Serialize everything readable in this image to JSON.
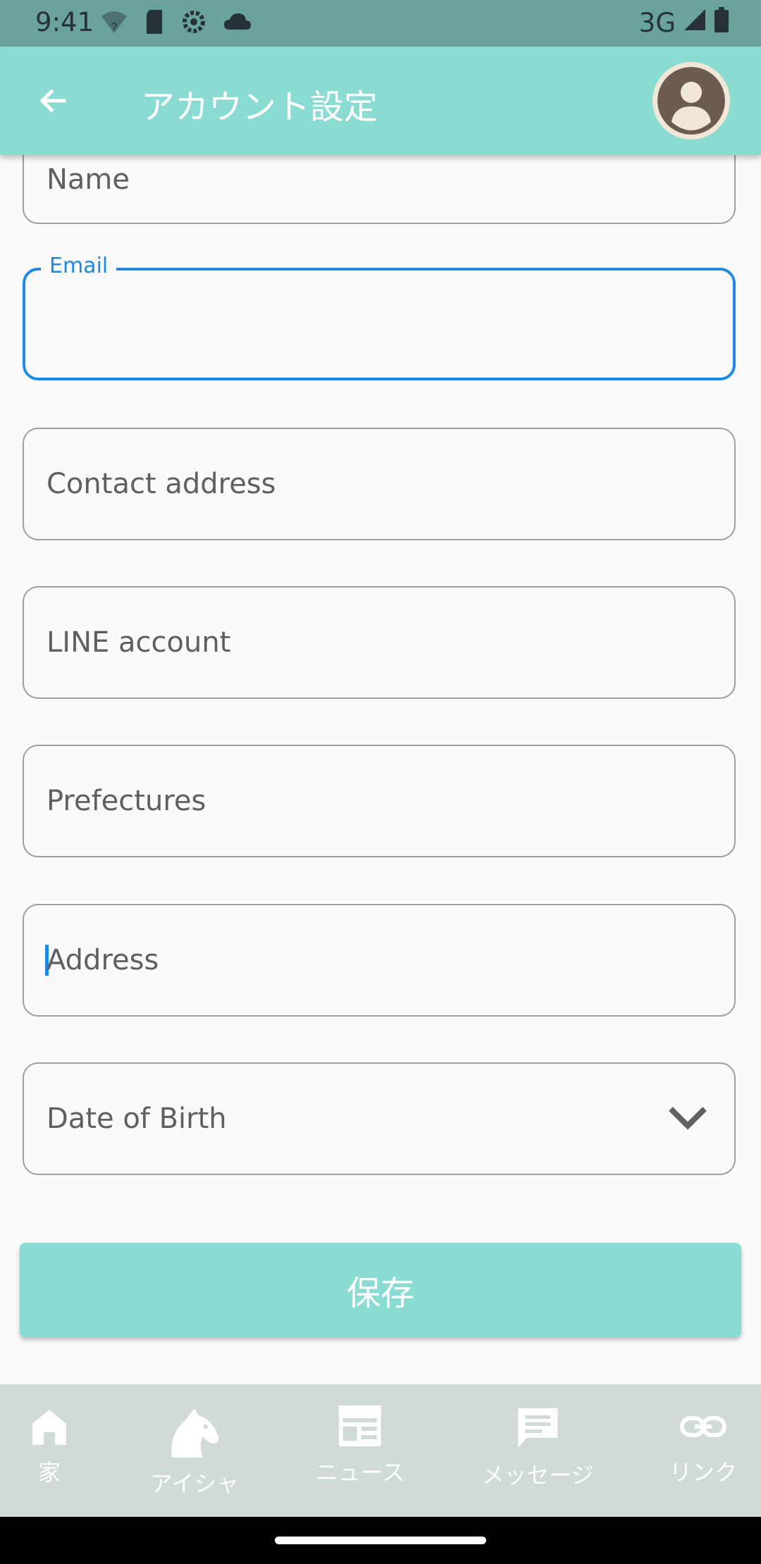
{
  "status_bar": {
    "time": "9:41",
    "network": "3G"
  },
  "app_bar": {
    "title": "アカウント設定",
    "back_icon": "arrow-left-icon",
    "avatar_icon": "account-circle-icon"
  },
  "form": {
    "name_placeholder": "Name",
    "email_label": "Email",
    "email_value": "",
    "contact_placeholder": "Contact address",
    "line_placeholder": "LINE account",
    "prefectures_placeholder": "Prefectures",
    "address_placeholder": "Address",
    "dob_placeholder": "Date of Birth"
  },
  "save_label": "保存",
  "bottom_nav": {
    "items": [
      {
        "label": "家",
        "icon": "home-icon"
      },
      {
        "label": "アイシャ",
        "icon": "horse-icon"
      },
      {
        "label": "ニュース",
        "icon": "newspaper-icon"
      },
      {
        "label": "メッセージ",
        "icon": "message-icon"
      },
      {
        "label": "リンク",
        "icon": "link-icon"
      }
    ]
  },
  "colors": {
    "accent": "#8adbd2",
    "focus": "#1e88e5",
    "status_bar": "#6aa39c",
    "nav_bg": "#cfdad9"
  }
}
